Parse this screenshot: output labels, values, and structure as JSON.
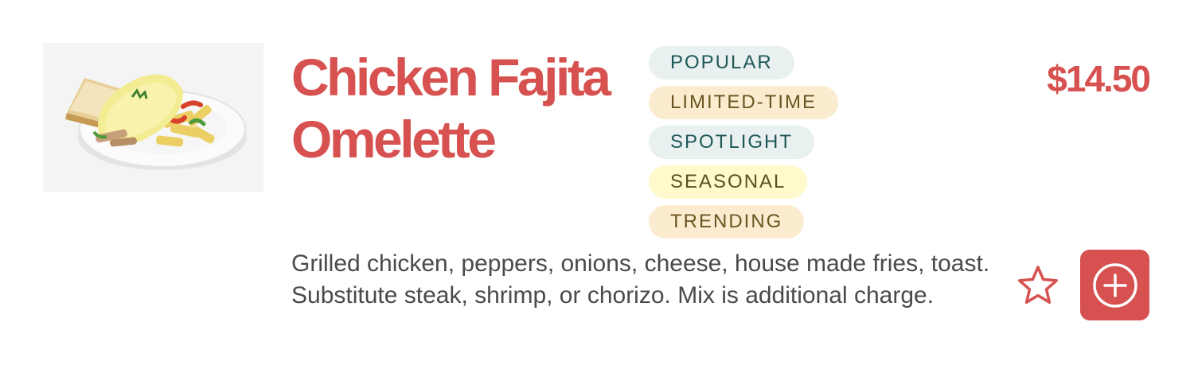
{
  "item": {
    "title": "Chicken Fajita Omelette",
    "price": "$14.50",
    "description": "Grilled chicken, peppers, onions, cheese, house made fries, toast. Substitute steak, shrimp, or chorizo. Mix is additional charge.",
    "image_alt": "Chicken Fajita Omelette",
    "tags": [
      {
        "label": "POPULAR",
        "bg": "#e8f0f0",
        "color": "#1f5757"
      },
      {
        "label": "LIMITED-TIME",
        "bg": "#fbecd0",
        "color": "#6b5520"
      },
      {
        "label": "SPOTLIGHT",
        "bg": "#e8f0f0",
        "color": "#1f5757"
      },
      {
        "label": "SEASONAL",
        "bg": "#fff9cc",
        "color": "#5a5020"
      },
      {
        "label": "TRENDING",
        "bg": "#fbecd0",
        "color": "#6b5520"
      }
    ]
  },
  "actions": {
    "favorite_icon": "star-outline-icon",
    "add_icon": "plus-circle-icon"
  },
  "colors": {
    "accent": "#d6514f",
    "text": "#4a4a4a"
  }
}
